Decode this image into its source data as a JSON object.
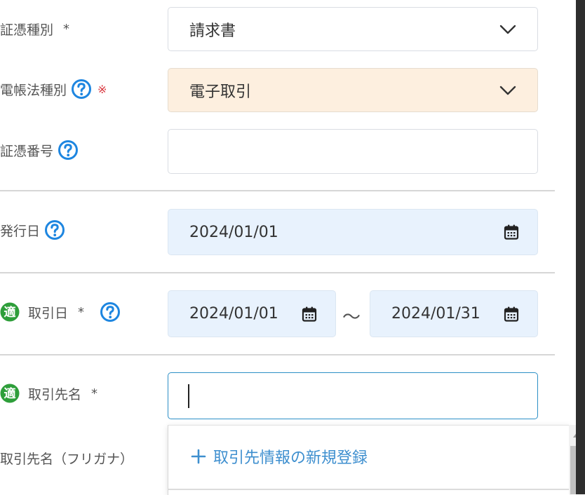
{
  "form": {
    "shouhyou_shubetsu": {
      "label": "証憑種別",
      "required_mark": "*",
      "value": "請求書"
    },
    "denchouhou_shubetsu": {
      "label": "電帳法種別",
      "required_mark": "※",
      "value": "電子取引"
    },
    "shouhyou_bangou": {
      "label": "証憑番号",
      "value": ""
    },
    "hakkou_bi": {
      "label": "発行日",
      "value": "2024/01/01"
    },
    "torihiki_bi": {
      "label": "取引日",
      "required_mark": "*",
      "from": "2024/01/01",
      "separator": "〜",
      "to": "2024/01/31"
    },
    "torihikisaki_mei": {
      "label": "取引先名",
      "required_mark": "*",
      "value": ""
    },
    "torihikisaki_furigana": {
      "label": "取引先名（フリガナ）"
    }
  },
  "badge": {
    "teki": "適"
  },
  "dropdown": {
    "add_new_label": "取引先情報の新規登録"
  },
  "colors": {
    "accent": "#2c8fc6",
    "help_icon": "#1e86e0",
    "teki_badge": "#2e9e3a",
    "required_red": "#d9363e",
    "peach_field": "#fdefdf",
    "date_field": "#e8f2fd"
  },
  "icons": [
    "help-circle-icon",
    "chevron-down-icon",
    "calendar-icon",
    "teki-badge-icon",
    "plus-icon"
  ]
}
